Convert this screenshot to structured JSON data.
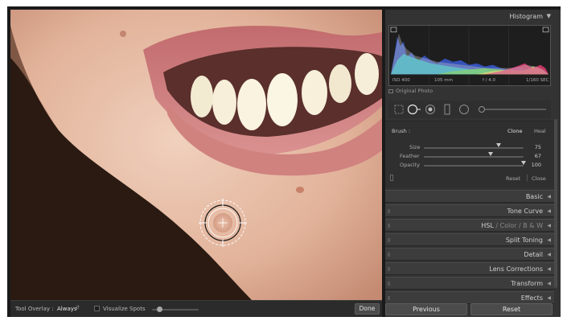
{
  "panel": {
    "histogram_title": "Histogram",
    "camera": {
      "iso": "ISO 400",
      "focal": "105 mm",
      "aperture": "f / 4.0",
      "shutter": "1/160 SEC"
    },
    "original_photo_label": "Original Photo"
  },
  "brush": {
    "label": "Brush :",
    "mode_clone": "Clone",
    "mode_heal": "Heal",
    "size": {
      "label": "Size",
      "value": "75",
      "fraction": 0.75
    },
    "feather": {
      "label": "Feather",
      "value": "67",
      "fraction": 0.67
    },
    "opacity": {
      "label": "Opacity",
      "value": "100",
      "fraction": 1.0
    },
    "reset": "Reset",
    "close": "Close"
  },
  "sections": [
    {
      "label": "Basic"
    },
    {
      "label": "Tone Curve"
    },
    {
      "label": "HSL"
    },
    {
      "label": "Split Toning"
    },
    {
      "label": "Detail"
    },
    {
      "label": "Lens Corrections"
    },
    {
      "label": "Transform"
    },
    {
      "label": "Effects"
    }
  ],
  "hsl_parts": {
    "hsl": "HSL",
    "sep": "/",
    "color": "Color",
    "bw": "B & W"
  },
  "toolbar": {
    "tool_overlay_label": "Tool Overlay :",
    "tool_overlay_value": "Always",
    "visualize_spots": "Visualize Spots",
    "done": "Done"
  },
  "buttons": {
    "previous": "Previous",
    "reset": "Reset"
  }
}
